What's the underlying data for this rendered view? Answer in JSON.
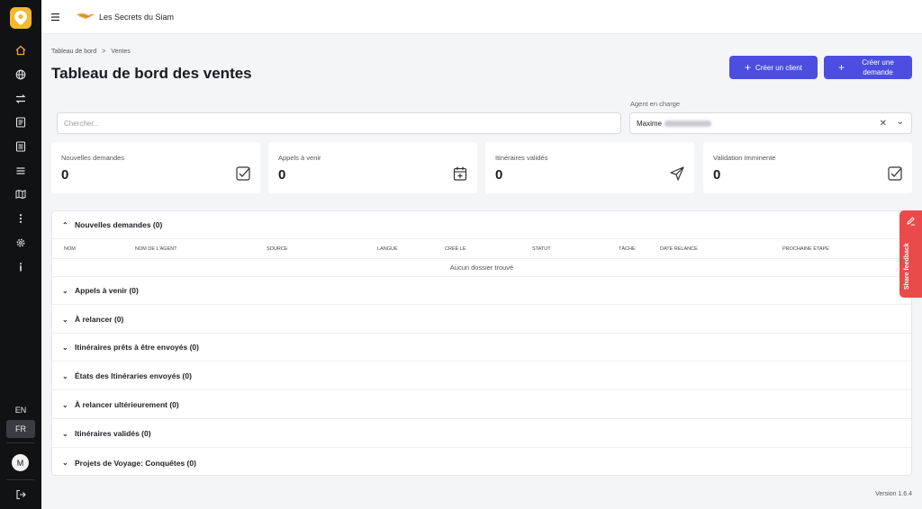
{
  "app": {
    "brand_name": "Les Secrets du Siam",
    "version": "Version 1.6.4"
  },
  "sidebar": {
    "icons": [
      "home-icon",
      "globe-icon",
      "transfer-icon",
      "document-icon",
      "list-document-icon",
      "menu-lines-icon",
      "map-icon",
      "more-vertical-icon",
      "settings-icon",
      "info-icon"
    ],
    "languages": [
      "EN",
      "FR"
    ],
    "active_language": "FR",
    "avatar_initial": "M"
  },
  "breadcrumb": {
    "root": "Tableau de bord",
    "separator": ">",
    "current": "Ventes"
  },
  "page": {
    "title": "Tableau de bord des ventes"
  },
  "actions": {
    "create_client": "Créer un client",
    "create_request": "Créer une demande"
  },
  "filters": {
    "search_placeholder": "Chercher...",
    "agent_label": "Agent en charge",
    "agent_value": "Maxime"
  },
  "stats": [
    {
      "label": "Nouvelles demandes",
      "value": "0",
      "icon": "checkbox-icon"
    },
    {
      "label": "Appels à venir",
      "value": "0",
      "icon": "calendar-plus-icon"
    },
    {
      "label": "Itinéraires validés",
      "value": "0",
      "icon": "send-icon"
    },
    {
      "label": "Validation Imminente",
      "value": "0",
      "icon": "checkbox-icon"
    }
  ],
  "sections": {
    "open": {
      "title": "Nouvelles demandes (0)",
      "columns": [
        "NOM",
        "NOM DE L'AGENT",
        "SOURCE",
        "LANGUE",
        "CRÉÉ LE",
        "STATUT",
        "TÂCHE",
        "DATE RELANCE",
        "PROCHAINE ÉTAPE"
      ],
      "empty_text": "Aucun dossier trouvé"
    },
    "collapsed": [
      "Appels à venir (0)",
      "À relancer (0)",
      "Itinéraires prêts à être envoyés (0)",
      "États des Itinéraries envoyés (0)",
      "À relancer ultérieurement (0)",
      "Itinéraires validés (0)",
      "Projets de Voyage: Conquêtes (0)"
    ]
  },
  "feedback": {
    "label": "Share feedback"
  },
  "colors": {
    "primary": "#4b4ee0",
    "sidebar_bg": "#111214",
    "logo": "#f5b82e",
    "feedback": "#e94b4b"
  }
}
